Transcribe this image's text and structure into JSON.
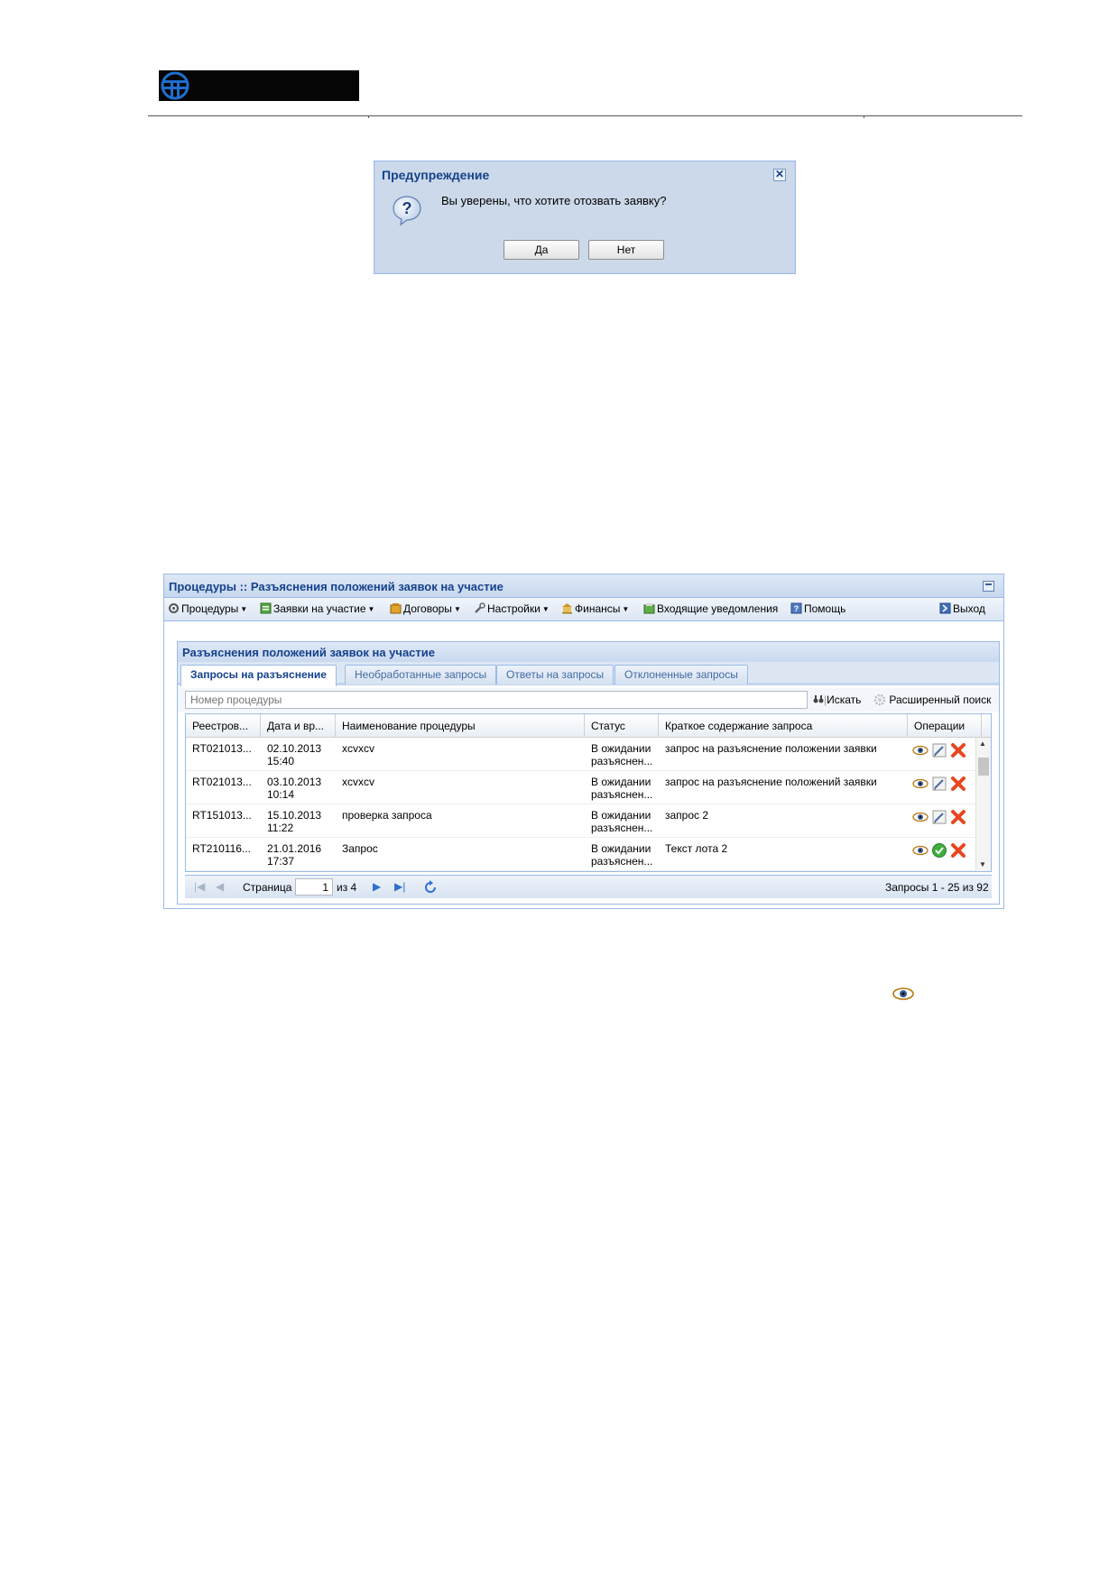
{
  "dialog": {
    "title": "Предупреждение",
    "close_glyph": "✕",
    "icon": "question-icon",
    "message": "Вы уверены, что хотите отозвать заявку?",
    "yes_label": "Да",
    "no_label": "Нет"
  },
  "panel": {
    "title": "Процедуры :: Разъяснения положений заявок на участие",
    "toolbar": [
      {
        "label": "Процедуры",
        "icon": "gears-icon",
        "dropdown": true
      },
      {
        "label": "Заявки на участие",
        "icon": "document-icon",
        "dropdown": true
      },
      {
        "label": "Договоры",
        "icon": "contracts-icon",
        "dropdown": true
      },
      {
        "label": "Настройки",
        "icon": "wrench-icon",
        "dropdown": true
      },
      {
        "label": "Финансы",
        "icon": "bank-icon",
        "dropdown": true
      },
      {
        "label": "Входящие уведомления",
        "icon": "inbox-icon",
        "dropdown": false
      },
      {
        "label": "Помощь",
        "icon": "help-icon",
        "dropdown": false
      },
      {
        "label": "Выход",
        "icon": "exit-icon",
        "dropdown": false
      }
    ],
    "subpanel_title": "Разъяснения положений заявок на участие",
    "tabs": [
      {
        "label": "Запросы на разъяснение",
        "active": true
      },
      {
        "label": "Необработанные запросы",
        "active": false
      },
      {
        "label": "Ответы на запросы",
        "active": false
      },
      {
        "label": "Отклоненные запросы",
        "active": false
      }
    ],
    "search": {
      "placeholder": "Номер процедуры",
      "search_label": "Искать",
      "advanced_label": "Расширенный поиск"
    },
    "grid": {
      "columns": [
        "Реестров...",
        "Дата и вр...",
        "Наименование процедуры",
        "Статус",
        "Краткое содержание запроса",
        "Операции"
      ],
      "rows": [
        {
          "reg": "RT021013...",
          "date1": "02.10.2013",
          "date2": "15:40",
          "name": "xcvxcv",
          "status1": "В ожидании",
          "status2": "разъяснен...",
          "summary": "запрос на разъяснение положении заявки",
          "ops": [
            "view",
            "edit",
            "delete"
          ]
        },
        {
          "reg": "RT021013...",
          "date1": "03.10.2013",
          "date2": "10:14",
          "name": "xcvxcv",
          "status1": "В ожидании",
          "status2": "разъяснен...",
          "summary": "запрос на разъяснение положений заявки",
          "ops": [
            "view",
            "edit",
            "delete"
          ]
        },
        {
          "reg": "RT151013...",
          "date1": "15.10.2013",
          "date2": "11:22",
          "name": "проверка запроса",
          "status1": "В ожидании",
          "status2": "разъяснен...",
          "summary": "запрос 2",
          "ops": [
            "view",
            "edit",
            "delete"
          ]
        },
        {
          "reg": "RT210116...",
          "date1": "21.01.2016",
          "date2": "17:37",
          "name": "Запрос",
          "status1": "В ожидании",
          "status2": "разъяснен...",
          "summary": "Текст лота 2",
          "ops": [
            "view",
            "approve",
            "delete"
          ]
        }
      ]
    },
    "pager": {
      "page_label": "Страница",
      "page_value": "1",
      "of_label": "из 4",
      "summary": "Запросы 1 - 25 из 92"
    }
  },
  "colors": {
    "header_blue": "#15428b",
    "border_blue": "#99bbe8",
    "delete_red": "#e8461d",
    "approve_green": "#3fae3f",
    "eye_orange": "#d98a18"
  }
}
